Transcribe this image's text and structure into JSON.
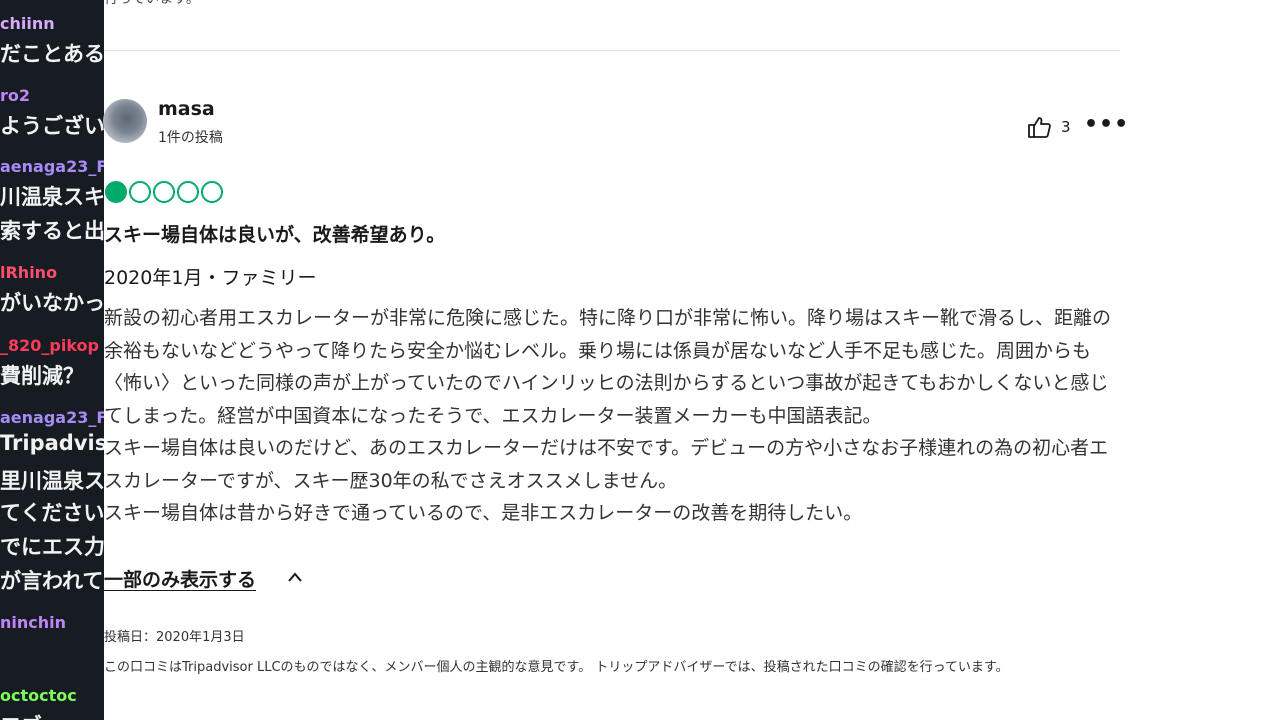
{
  "chat": {
    "messages": [
      {
        "user": "chiinn",
        "user_color": "#d8aaff",
        "text": "だことある"
      },
      {
        "user": "ro2",
        "user_color": "#c084fc",
        "text": "ようござい"
      },
      {
        "user": "aenaga23_F",
        "user_color": "#a78bfa",
        "text": "川温泉スキ"
      },
      {
        "user": "",
        "user_color": "#a78bfa",
        "text": "索すると出"
      },
      {
        "user": "lRhino",
        "user_color": "#ff4d6d",
        "text": "がいなかっ"
      },
      {
        "user": "_820_pikop",
        "user_color": "#ff3b5c",
        "text": "費削減？"
      },
      {
        "user": "aenaga23_F",
        "user_color": "#a78bfa",
        "text": "Tripadvis"
      },
      {
        "user": "",
        "user_color": "#a78bfa",
        "text": "里川温泉ス"
      },
      {
        "user": "",
        "user_color": "#a78bfa",
        "text": "てください"
      },
      {
        "user": "",
        "user_color": "#a78bfa",
        "text": "でにエス力"
      },
      {
        "user": "",
        "user_color": "#a78bfa",
        "text": "が言われて"
      },
      {
        "user": "ninchin",
        "user_color": "#c084fc",
        "text": ""
      },
      {
        "user": "octoctoc",
        "user_color": "#7dff5a",
        "text": "ロゴ  ー"
      }
    ]
  },
  "review": {
    "prev_fragment": "行っています。",
    "reviewer": {
      "name": "masa",
      "contributions": "1件の投稿"
    },
    "helpful_count": "3",
    "more_icon": "•••",
    "rating": {
      "value": 1,
      "max": 5,
      "color": "#00aa6c"
    },
    "title": "スキー場自体は良いが、改善希望あり。",
    "date_line": "2020年1月・ファミリー",
    "body_paragraphs": [
      "新設の初心者用エスカレーターが非常に危険に感じた。特に降り口が非常に怖い。降り場はスキー靴で滑るし、距離の余裕もないなどどうやって降りたら安全か悩むレベル。乗り場には係員が居ないなど人手不足も感じた。周囲からも〈怖い〉といった同様の声が上がっていたのでハインリッヒの法則からするといつ事故が起きてもおかしくないと感じてしまった。経営が中国資本になったそうで、エスカレーター装置メーカーも中国語表記。",
      "スキー場自体は良いのだけど、あのエスカレーターだけは不安です。デビューの方や小さなお子様連れの為の初心者エスカレーターですが、スキー歴30年の私でさえオススメしません。",
      "スキー場自体は昔から好きで通っているので、是非エスカレーターの改善を期待したい。"
    ],
    "show_less_label": "一部のみ表示する",
    "posted_date": "投稿日：2020年1月3日",
    "disclaimer": "この口コミはTripadvisor LLCのものではなく、メンバー個人の主観的な意見です。 トリップアドバイザーでは、投稿された口コミの確認を行っています。"
  }
}
